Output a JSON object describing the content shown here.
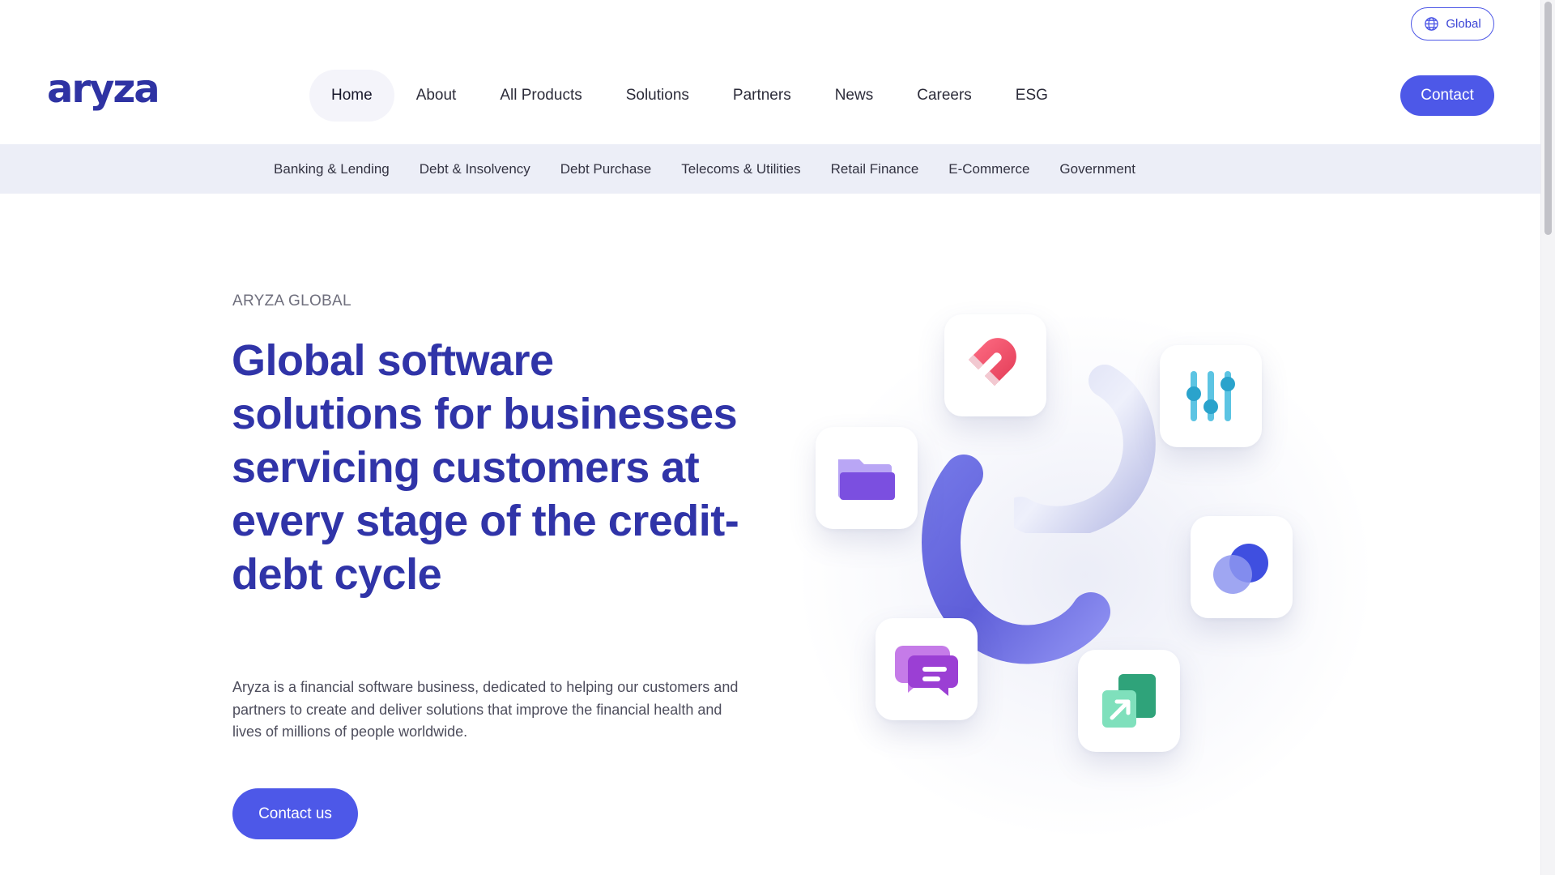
{
  "header": {
    "logo_text": "aryza",
    "region_button": "Global",
    "nav": [
      {
        "label": "Home",
        "active": true
      },
      {
        "label": "About",
        "active": false
      },
      {
        "label": "All Products",
        "active": false
      },
      {
        "label": "Solutions",
        "active": false
      },
      {
        "label": "Partners",
        "active": false
      },
      {
        "label": "News",
        "active": false
      },
      {
        "label": "Careers",
        "active": false
      },
      {
        "label": "ESG",
        "active": false
      }
    ],
    "contact_button": "Contact"
  },
  "subnav": [
    "Banking & Lending",
    "Debt & Insolvency",
    "Debt Purchase",
    "Telecoms & Utilities",
    "Retail Finance",
    "E-Commerce",
    "Government"
  ],
  "hero": {
    "eyebrow": "ARYZA GLOBAL",
    "title": "Global software solutions for businesses servicing customers at every stage of the credit-debt cycle",
    "description": "Aryza is a financial software business, dedicated to helping our customers and partners to create and deliver solutions that improve the financial health and lives of millions of people worldwide.",
    "cta": "Contact us"
  },
  "illustration": {
    "icons": [
      "magnet-icon",
      "sliders-icon",
      "folder-icon",
      "circles-icon",
      "chat-icon",
      "arrow-square-icon"
    ]
  },
  "colors": {
    "brand_primary": "#4d58e8",
    "heading": "#3034a8",
    "subnav_bg": "#eceef7"
  }
}
